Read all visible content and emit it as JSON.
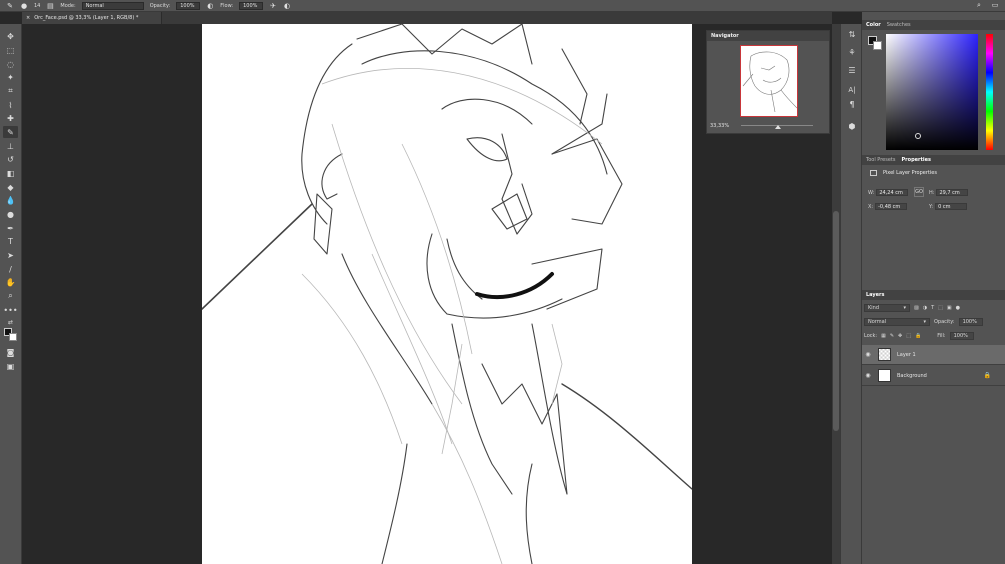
{
  "options_bar": {
    "brush_size": "14",
    "mode_label": "Mode:",
    "mode_value": "Normal",
    "opacity_label": "Opacity:",
    "opacity_value": "100%",
    "flow_label": "Flow:",
    "flow_value": "100%"
  },
  "document_tab": {
    "title": "Orc_Face.psd @ 33,3% (Layer 1, RGB/8) *"
  },
  "navigator": {
    "title": "Navigator",
    "zoom": "33,33%"
  },
  "color_panel": {
    "tabs": [
      "Color",
      "Swatches"
    ],
    "hue_color": "#2d22ff"
  },
  "properties_panel": {
    "tabs": [
      "Tool Presets",
      "Properties"
    ],
    "title": "Pixel Layer Properties",
    "w_label": "W:",
    "w_value": "24,24 cm",
    "h_label": "H:",
    "h_value": "29,7 cm",
    "x_label": "X:",
    "x_value": "-0,48 cm",
    "y_label": "Y:",
    "y_value": "0 cm",
    "link_label": "GO"
  },
  "layers_panel": {
    "title": "Layers",
    "filter_value": "Kind",
    "blend_mode": "Normal",
    "opacity_label": "Opacity:",
    "opacity_value": "100%",
    "lock_label": "Lock:",
    "fill_label": "Fill:",
    "fill_value": "100%",
    "layers": [
      {
        "name": "Layer 1",
        "selected": true
      },
      {
        "name": "Background",
        "locked": true
      }
    ]
  },
  "colors": {
    "ui_panel": "#535353",
    "pasteboard": "#282828",
    "navigator_frame": "#c8363a"
  }
}
